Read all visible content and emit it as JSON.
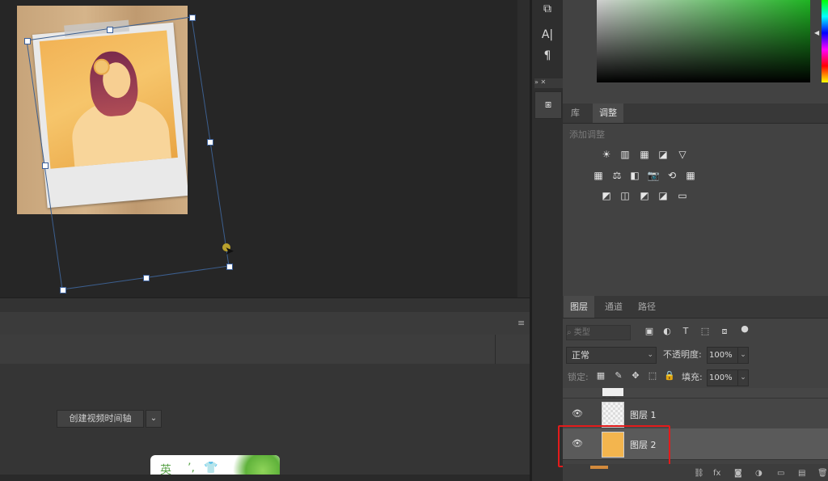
{
  "timeline": {
    "create_button": "创建视频时间轴",
    "dropdown": "⌄"
  },
  "ime": {
    "label": "英",
    "dot": "’,",
    "shirt": "👕"
  },
  "tools": {
    "items": [
      {
        "icon": "adjust-sliders-icon",
        "glyph": "⧉"
      },
      {
        "icon": "character-icon",
        "glyph": "A|"
      },
      {
        "icon": "paragraph-icon",
        "glyph": "¶"
      }
    ],
    "mini_header": "» ✕",
    "mini_button_glyph": "⧆"
  },
  "adjustments": {
    "tabs": [
      "库",
      "调整"
    ],
    "active_tab": "调整",
    "add_label": "添加调整",
    "rows": [
      [
        "☀",
        "▥",
        "▦",
        "◪",
        "▽"
      ],
      [
        "▦",
        "⚖",
        "◧",
        "📷",
        "⟲",
        "▦"
      ],
      [
        "◩",
        "◫",
        "◩",
        "◪",
        "▭"
      ]
    ]
  },
  "layers": {
    "tabs": [
      "图层",
      "通道",
      "路径"
    ],
    "active_tab": "图层",
    "filter_placeholder": "⌕ 类型",
    "filter_icons": [
      "▣",
      "◐",
      "T",
      "⬚",
      "⧈",
      "●"
    ],
    "blend_mode": "正常",
    "opacity_label": "不透明度:",
    "opacity_value": "100%",
    "lock_label": "锁定:",
    "lock_icons": [
      "▦",
      "✎",
      "✥",
      "⬚",
      "🔒"
    ],
    "fill_label": "填充:",
    "fill_value": "100%",
    "top_partial_label": "▪ ▫▫",
    "rows": [
      {
        "name": "图层 1",
        "visible": true,
        "selected": false
      },
      {
        "name": "图层 2",
        "visible": true,
        "selected": true
      }
    ],
    "footer_icons": [
      "⛓",
      "fx",
      "◙",
      "◑",
      "▭",
      "▤",
      "🗑"
    ]
  },
  "colors": {
    "highlight": "#e31b1b",
    "accent_green": "#1fb323"
  }
}
